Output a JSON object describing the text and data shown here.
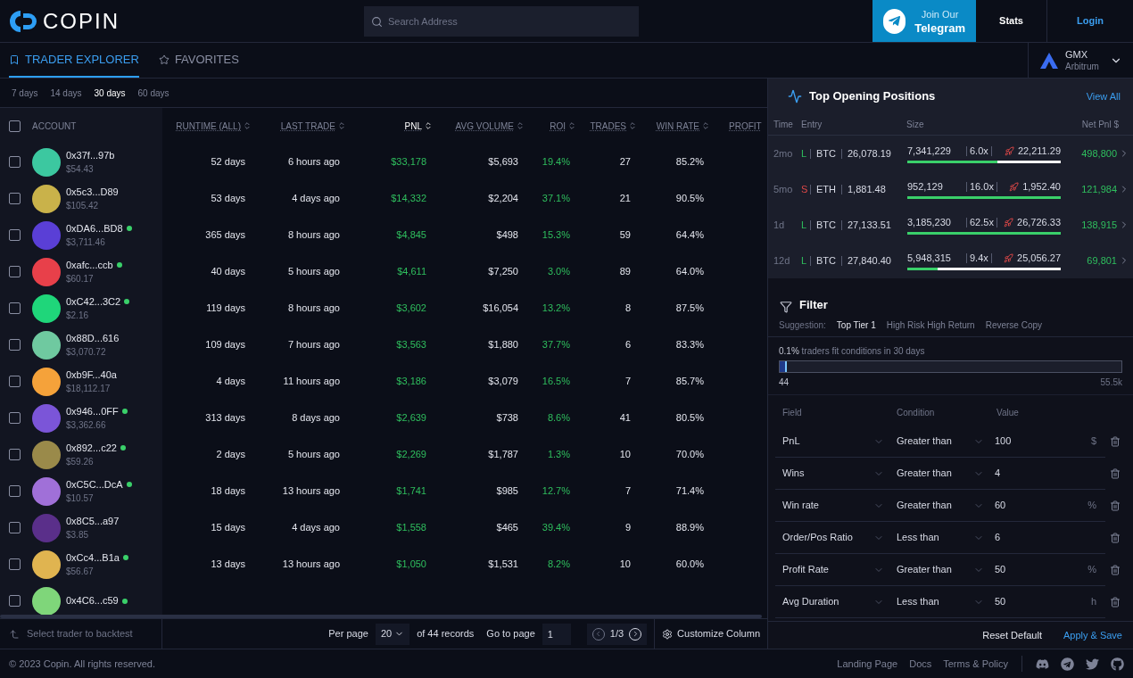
{
  "header": {
    "brand": "COPIN",
    "search": {
      "placeholder": "Search Address"
    },
    "telegram": {
      "line1": "Join Our",
      "line2": "Telegram"
    },
    "stats": "Stats",
    "login": "Login"
  },
  "tabs": [
    {
      "label": "TRADER EXPLORER",
      "selected": true
    },
    {
      "label": "FAVORITES",
      "selected": false
    }
  ],
  "protocol": {
    "name": "GMX",
    "network": "Arbitrum"
  },
  "periods": [
    {
      "label": "7 days",
      "selected": false
    },
    {
      "label": "14 days",
      "selected": false
    },
    {
      "label": "30 days",
      "selected": true
    },
    {
      "label": "60 days",
      "selected": false
    }
  ],
  "table": {
    "select_all": false,
    "columns": [
      {
        "label": "ACCOUNT",
        "sorted": false
      },
      {
        "label": "RUNTIME (ALL)",
        "sorted": false
      },
      {
        "label": "LAST TRADE",
        "sorted": false
      },
      {
        "label": "PNL",
        "sorted": true
      },
      {
        "label": "AVG VOLUME",
        "sorted": false
      },
      {
        "label": "ROI",
        "sorted": false
      },
      {
        "label": "TRADES",
        "sorted": false
      },
      {
        "label": "WIN RATE",
        "sorted": false
      },
      {
        "label": "PROFIT",
        "sorted": false
      }
    ],
    "rows": [
      {
        "account": "0x37f...97b",
        "balance": "$54.43",
        "online": false,
        "color": "#3cc8a0",
        "checked": false,
        "cells": [
          "52 days",
          "6 hours ago",
          "$33,178",
          "$5,693",
          "19.4%",
          "27",
          "85.2%"
        ]
      },
      {
        "account": "0x5c3...D89",
        "balance": "$105.42",
        "online": false,
        "color": "#c9b24a",
        "checked": false,
        "cells": [
          "53 days",
          "4 days ago",
          "$14,332",
          "$2,204",
          "37.1%",
          "21",
          "90.5%"
        ]
      },
      {
        "account": "0xDA6...BD8",
        "balance": "$3,711.46",
        "online": true,
        "color": "#5a3fd6",
        "checked": false,
        "cells": [
          "365 days",
          "8 hours ago",
          "$4,845",
          "$498",
          "15.3%",
          "59",
          "64.4%"
        ]
      },
      {
        "account": "0xafc...ccb",
        "balance": "$60.17",
        "online": true,
        "color": "#e8404a",
        "checked": false,
        "cells": [
          "40 days",
          "5 hours ago",
          "$4,611",
          "$7,250",
          "3.0%",
          "89",
          "64.0%"
        ]
      },
      {
        "account": "0xC42...3C2",
        "balance": "$2.16",
        "online": true,
        "color": "#1fd67a",
        "checked": false,
        "cells": [
          "119 days",
          "8 hours ago",
          "$3,602",
          "$16,054",
          "13.2%",
          "8",
          "87.5%"
        ]
      },
      {
        "account": "0x88D...616",
        "balance": "$3,070.72",
        "online": false,
        "color": "#6fc9a0",
        "checked": false,
        "cells": [
          "109 days",
          "7 hours ago",
          "$3,563",
          "$1,880",
          "37.7%",
          "6",
          "83.3%"
        ]
      },
      {
        "account": "0xb9F...40a",
        "balance": "$18,112.17",
        "online": false,
        "color": "#f5a23a",
        "checked": false,
        "cells": [
          "4 days",
          "11 hours ago",
          "$3,186",
          "$3,079",
          "16.5%",
          "7",
          "85.7%"
        ]
      },
      {
        "account": "0x946...0FF",
        "balance": "$3,362.66",
        "online": true,
        "color": "#7b55d8",
        "checked": false,
        "cells": [
          "313 days",
          "8 days ago",
          "$2,639",
          "$738",
          "8.6%",
          "41",
          "80.5%"
        ]
      },
      {
        "account": "0x892...c22",
        "balance": "$59.26",
        "online": true,
        "color": "#9a8a4a",
        "checked": false,
        "cells": [
          "2 days",
          "5 hours ago",
          "$2,269",
          "$1,787",
          "1.3%",
          "10",
          "70.0%"
        ]
      },
      {
        "account": "0xC5C...DcA",
        "balance": "$10.57",
        "online": true,
        "color": "#a070d8",
        "checked": false,
        "cells": [
          "18 days",
          "13 hours ago",
          "$1,741",
          "$985",
          "12.7%",
          "7",
          "71.4%"
        ]
      },
      {
        "account": "0x8C5...a97",
        "balance": "$3.85",
        "online": false,
        "color": "#5a2f8a",
        "checked": false,
        "cells": [
          "15 days",
          "4 days ago",
          "$1,558",
          "$465",
          "39.4%",
          "9",
          "88.9%"
        ]
      },
      {
        "account": "0xCc4...B1a",
        "balance": "$56.67",
        "online": true,
        "color": "#e0b450",
        "checked": false,
        "cells": [
          "13 days",
          "13 hours ago",
          "$1,050",
          "$1,531",
          "8.2%",
          "10",
          "60.0%"
        ]
      },
      {
        "account": "0x4C6...c59",
        "online": true,
        "color": "#7fd67a",
        "checked": false
      }
    ]
  },
  "bottom_bar": {
    "backtest": "Select trader to backtest",
    "per_page_label": "Per page",
    "per_page": "20",
    "records": "of 44 records",
    "goto_label": "Go to page",
    "goto_value": "1",
    "page": "1/3",
    "customize": "Customize Column"
  },
  "positions": {
    "title": "Top Opening Positions",
    "view_all": "View All",
    "columns": [
      "Time",
      "Entry",
      "Size",
      "Net Pnl $"
    ],
    "rows": [
      {
        "time": "2mo",
        "side": "L",
        "kind": "long",
        "pair": "BTC",
        "entry": "26,078.19",
        "size": "7,341,229",
        "leverage": "6.0x",
        "liquidation": "22,211.29",
        "level": 0.59,
        "pnl": "498,800"
      },
      {
        "time": "5mo",
        "side": "S",
        "kind": "short",
        "pair": "ETH",
        "entry": "1,881.48",
        "size": "952,129",
        "leverage": "16.0x",
        "liquidation": "1,952.40",
        "level": 1,
        "pnl": "121,984"
      },
      {
        "time": "1d",
        "side": "L",
        "kind": "long",
        "pair": "BTC",
        "entry": "27,133.51",
        "size": "3,185,230",
        "leverage": "62.5x",
        "liquidation": "26,726.33",
        "level": 1,
        "pnl": "138,915"
      },
      {
        "time": "12d",
        "side": "L",
        "kind": "long",
        "pair": "BTC",
        "entry": "27,840.40",
        "size": "5,948,315",
        "leverage": "9.4x",
        "liquidation": "25,056.27",
        "level": 0.2,
        "pnl": "69,801"
      }
    ]
  },
  "filter": {
    "title": "Filter",
    "suggestion_label": "Suggestion:",
    "suggestions": [
      {
        "label": "Top Tier 1",
        "selected": true
      },
      {
        "label": "High Risk High Return",
        "selected": false
      },
      {
        "label": "Reverse Copy",
        "selected": false
      }
    ],
    "fit_percent": "0.1%",
    "fit_text": "traders fit conditions in 30 days",
    "level": 0.02,
    "min": "44",
    "max": "55.5k",
    "columns": [
      "Field",
      "Condition",
      "Value"
    ],
    "rows": [
      {
        "field": "PnL",
        "condition": "Greater than",
        "value": "100",
        "unit": "$"
      },
      {
        "field": "Wins",
        "condition": "Greater than",
        "value": "4"
      },
      {
        "field": "Win rate",
        "condition": "Greater than",
        "value": "60",
        "unit": "%"
      },
      {
        "field": "Order/Pos Ratio",
        "condition": "Less than",
        "value": "6"
      },
      {
        "field": "Profit Rate",
        "condition": "Greater than",
        "value": "50",
        "unit": "%"
      },
      {
        "field": "Avg Duration",
        "condition": "Less than",
        "value": "50",
        "unit": "h"
      }
    ],
    "reset": "Reset Default",
    "apply": "Apply & Save"
  },
  "footer": {
    "copyright": "© 2023 Copin. All rights reserved.",
    "links": [
      "Landing Page",
      "Docs",
      "Terms & Policy"
    ]
  }
}
